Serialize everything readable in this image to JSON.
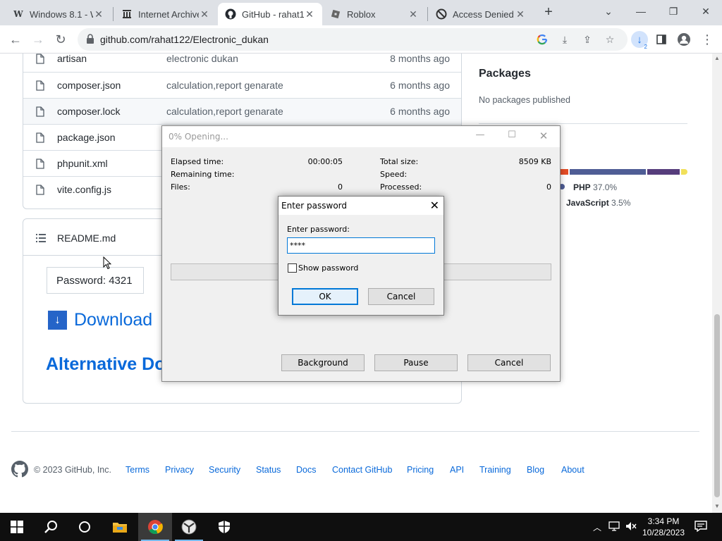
{
  "browser": {
    "tabs": [
      {
        "title": "Windows 8.1 - W",
        "favicon": "wikipedia-icon",
        "active": false
      },
      {
        "title": "Internet Archive",
        "favicon": "archive-icon",
        "active": false
      },
      {
        "title": "GitHub - rahat1",
        "favicon": "github-icon",
        "active": true
      },
      {
        "title": "Roblox",
        "favicon": "roblox-icon",
        "active": false
      },
      {
        "title": "Access Denied",
        "favicon": "access-denied-icon",
        "active": false
      }
    ],
    "url": "github.com/rahat122/Electronic_dukan",
    "download_badge": "2"
  },
  "files": [
    {
      "name": "artisan",
      "message": "electronic dukan",
      "age": "8 months ago"
    },
    {
      "name": "composer.json",
      "message": "calculation,report genarate",
      "age": "6 months ago"
    },
    {
      "name": "composer.lock",
      "message": "calculation,report genarate",
      "age": "6 months ago"
    },
    {
      "name": "package.json",
      "message": "",
      "age": ""
    },
    {
      "name": "phpunit.xml",
      "message": "",
      "age": ""
    },
    {
      "name": "vite.config.js",
      "message": "",
      "age": ""
    }
  ],
  "readme": {
    "title": "README.md",
    "password_text": "Password: 4321",
    "download_label": "Download",
    "alt_download_label": "Alternative Dov"
  },
  "sidebar": {
    "packages_title": "Packages",
    "packages_empty": "No packages published",
    "languages": [
      {
        "name": "PHP",
        "percent": "37.0%",
        "color": "#4F5D95"
      },
      {
        "name": "JavaScript",
        "percent": "3.5%",
        "color": "#f1e05a"
      }
    ]
  },
  "footer": {
    "copyright": "© 2023 GitHub, Inc.",
    "links": [
      "Terms",
      "Privacy",
      "Security",
      "Status",
      "Docs",
      "Contact GitHub",
      "Pricing",
      "API",
      "Training",
      "Blog",
      "About"
    ]
  },
  "opening_dialog": {
    "title": "0% Opening...",
    "elapsed_label": "Elapsed time:",
    "elapsed_value": "00:00:05",
    "remaining_label": "Remaining time:",
    "files_label": "Files:",
    "files_value": "0",
    "total_size_label": "Total size:",
    "total_size_value": "8509 KB",
    "speed_label": "Speed:",
    "processed_label": "Processed:",
    "processed_value": "0",
    "progress": 0,
    "buttons": {
      "background": "Background",
      "pause": "Pause",
      "cancel": "Cancel"
    }
  },
  "password_dialog": {
    "title": "Enter password",
    "label": "Enter password:",
    "value": "****",
    "show_password_label": "Show password",
    "show_password_checked": false,
    "ok_label": "OK",
    "cancel_label": "Cancel"
  },
  "taskbar": {
    "time": "3:34 PM",
    "date": "10/28/2023"
  }
}
